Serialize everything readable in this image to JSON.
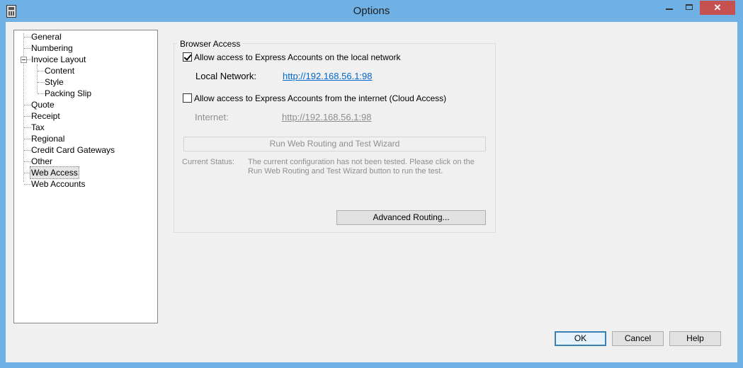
{
  "window": {
    "title": "Options",
    "close_glyph": "✕"
  },
  "tree": {
    "items": [
      {
        "label": "General"
      },
      {
        "label": "Numbering"
      },
      {
        "label": "Invoice Layout"
      },
      {
        "label": "Content"
      },
      {
        "label": "Style"
      },
      {
        "label": "Packing Slip"
      },
      {
        "label": "Quote"
      },
      {
        "label": "Receipt"
      },
      {
        "label": "Tax"
      },
      {
        "label": "Regional"
      },
      {
        "label": "Credit Card Gateways"
      },
      {
        "label": "Other"
      },
      {
        "label": "Web Access"
      },
      {
        "label": "Web Accounts"
      }
    ],
    "selected": "Web Access"
  },
  "browser_access": {
    "group_label": "Browser Access",
    "local_checkbox_label": "Allow access to Express Accounts on the local network",
    "local_checked": true,
    "local_network_label": "Local Network:",
    "local_network_url": "http://192.168.56.1:98",
    "internet_checkbox_label": "Allow access to Express Accounts from the internet (Cloud Access)",
    "internet_checked": false,
    "internet_label": "Internet:",
    "internet_url": "http://192.168.56.1:98",
    "wizard_button": "Run Web Routing and Test Wizard",
    "status_label": "Current Status:",
    "status_text": "The current configuration has not been tested. Please click on the Run Web Routing and Test Wizard button to run the test.",
    "advanced_button": "Advanced Routing..."
  },
  "footer": {
    "ok_label": "OK",
    "cancel_label": "Cancel",
    "help_label": "Help"
  },
  "colors": {
    "titlebar": "#6fb1e4",
    "close_button": "#c75050",
    "link": "#0066cc",
    "disabled_text": "#8e8e8e"
  }
}
